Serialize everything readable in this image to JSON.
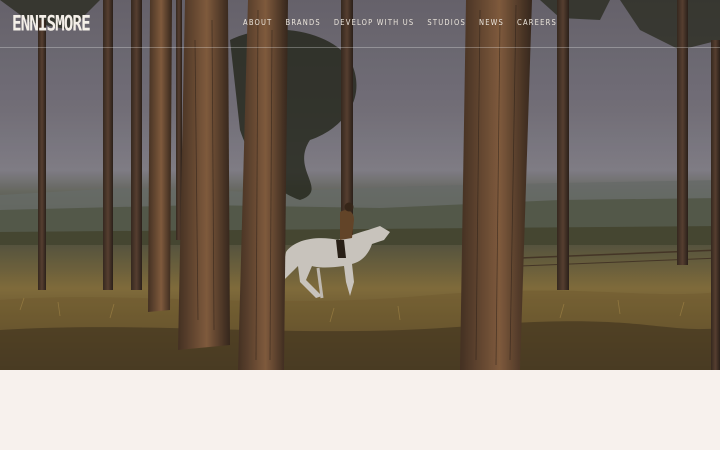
{
  "brand": {
    "logo_text": "ENNISMORE"
  },
  "nav": {
    "items": [
      {
        "label": "ABOUT"
      },
      {
        "label": "BRANDS"
      },
      {
        "label": "DEVELOP WITH US"
      },
      {
        "label": "STUDIOS"
      },
      {
        "label": "NEWS"
      },
      {
        "label": "CAREERS"
      }
    ]
  },
  "hero": {
    "scene": "horse rider among pine trees in golden field"
  },
  "colors": {
    "page_background": "#f7f1ed",
    "nav_text": "#ece6dd"
  }
}
